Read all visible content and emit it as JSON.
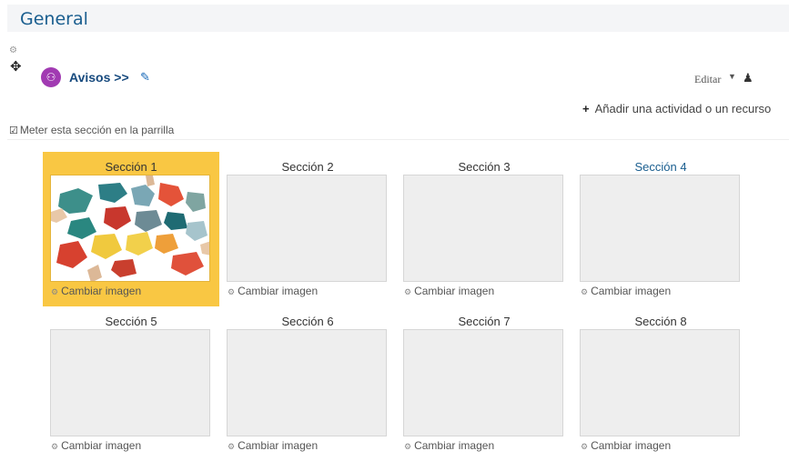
{
  "header": {
    "title": "General"
  },
  "section_block": {
    "settings_icon": "gear-icon",
    "move_icon": "move-icon",
    "forum_icon": "people-icon",
    "forum_title": "Avisos >>",
    "edit_icon": "pencil-icon",
    "edit_menu_label": "Editar",
    "add_activity_label": "Añadir una actividad o un recurso",
    "grid_toggle_label": "Meter esta sección en la parrilla"
  },
  "colors": {
    "accent": "#1a5e8f",
    "highlight": "#f9c743",
    "avatar": "#a13ab2"
  },
  "tiles": [
    {
      "label": "Sección 1",
      "change": "Cambiar imagen",
      "selected": true,
      "has_image": true
    },
    {
      "label": "Sección 2",
      "change": "Cambiar imagen"
    },
    {
      "label": "Sección 3",
      "change": "Cambiar imagen"
    },
    {
      "label": "Sección 4",
      "change": "Cambiar imagen",
      "label_color": "#1a5e8f"
    },
    {
      "label": "Sección 5",
      "change": "Cambiar imagen"
    },
    {
      "label": "Sección 6",
      "change": "Cambiar imagen"
    },
    {
      "label": "Sección 7",
      "change": "Cambiar imagen"
    },
    {
      "label": "Sección 8",
      "change": "Cambiar imagen"
    }
  ]
}
